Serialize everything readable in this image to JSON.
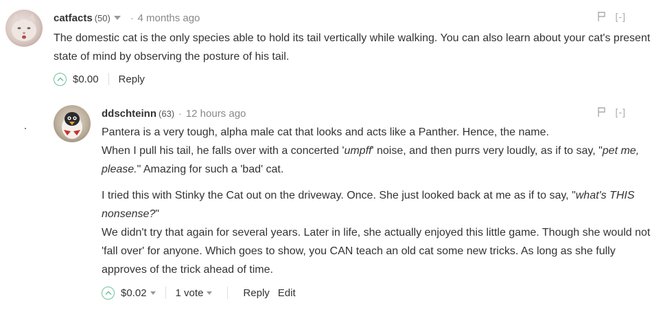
{
  "comments": [
    {
      "username": "catfacts",
      "reputation": "(50)",
      "separator": "·",
      "time": "4 months ago",
      "collapse": "[-]",
      "paragraphs": [
        [
          {
            "text": "The domestic cat is the only species able to hold its tail vertically while walking. You can also learn about your cat's present state of mind by observing the posture of his tail.",
            "em": false
          }
        ]
      ],
      "amount": "$0.00",
      "actions": [
        "Reply"
      ]
    },
    {
      "username": "ddschteinn",
      "reputation": "(63)",
      "separator": "·",
      "time": "12 hours ago",
      "collapse": "[-]",
      "paragraphs": [
        [
          {
            "text": "Pantera is a very tough, alpha male cat that looks and acts like a Panther. Hence, the name.",
            "em": false
          },
          {
            "br": true
          },
          {
            "text": "When I pull his tail, he falls over with a concerted '",
            "em": false
          },
          {
            "text": "umpff",
            "em": true
          },
          {
            "text": "' noise, and then purrs very loudly, as if to say, \"",
            "em": false
          },
          {
            "text": "pet me, please.",
            "em": true
          },
          {
            "text": "\" Amazing for such a 'bad' cat.",
            "em": false
          }
        ],
        [
          {
            "text": "I tried this with Stinky the Cat out on the driveway. Once. She just looked back at me as if to say, \"",
            "em": false
          },
          {
            "text": "what's THIS nonsense?",
            "em": true
          },
          {
            "text": "\"",
            "em": false
          },
          {
            "br": true
          },
          {
            "text": "We didn't try that again for several years. Later in life, she actually enjoyed this little game. Though she would not 'fall over' for anyone. Which goes to show, you CAN teach an old cat some new tricks. As long as she fully approves of the trick ahead of time.",
            "em": false
          }
        ]
      ],
      "amount": "$0.02",
      "votes": "1 vote",
      "actions": [
        "Reply",
        "Edit"
      ]
    }
  ],
  "colors": {
    "upvote": "#6cc09a",
    "text": "#333333",
    "muted": "#888888"
  },
  "icons": {
    "upvote": "chevron-up-circle-icon",
    "flag": "flag-icon",
    "dropdown": "caret-down-icon"
  }
}
